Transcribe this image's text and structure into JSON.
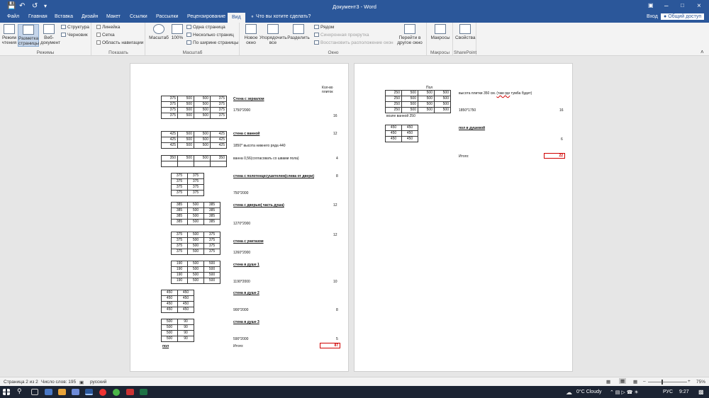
{
  "titlebar": {
    "title": "Документ3 - Word"
  },
  "tabs": [
    "Файл",
    "Главная",
    "Вставка",
    "Дизайн",
    "Макет",
    "Ссылки",
    "Рассылки",
    "Рецензирование",
    "Вид"
  ],
  "tellme": "Что вы хотите сделать?",
  "account": {
    "signin": "Вход",
    "share": "Общий доступ"
  },
  "ribbon": {
    "views": {
      "read": "Режим\nчтения",
      "print": "Разметка\nстраницы",
      "web": "Веб-\nдокумент",
      "outline": "Структура",
      "draft": "Черновик",
      "label": "Режимы"
    },
    "show": {
      "ruler": "Линейка",
      "grid": "Сетка",
      "nav": "Область навигации",
      "label": "Показать"
    },
    "zoom": {
      "zoom": "Масштаб",
      "hundred": "100%",
      "one": "Одна страница",
      "multi": "Несколько страниц",
      "width": "По ширине страницы",
      "label": "Масштаб"
    },
    "window": {
      "new": "Новое\nокно",
      "arrange": "Упорядочить\nвсе",
      "split": "Разделить",
      "side": "Рядом",
      "sync": "Синхронная прокрутка",
      "reset": "Восстановить расположение окон",
      "switch": "Перейти в\nдругое окно",
      "label": "Окно"
    },
    "macros": {
      "macros": "Макросы",
      "label": "Макросы"
    },
    "sp": {
      "props": "Свойства",
      "label": "SharePoint"
    }
  },
  "page1": {
    "header": "Кол-во\nплиток",
    "s1": {
      "rows": [
        [
          "375",
          "500",
          "500",
          "375"
        ],
        [
          "375",
          "500",
          "500",
          "375"
        ],
        [
          "375",
          "500",
          "500",
          "375"
        ],
        [
          "375",
          "500",
          "500",
          "375"
        ]
      ],
      "title": "Стена с зеркалом",
      "dim": "1750*2000",
      "count": "16"
    },
    "s2": {
      "rows": [
        [
          "425",
          "500",
          "500",
          "425"
        ],
        [
          "425",
          "500",
          "500",
          "425"
        ],
        [
          "425",
          "500",
          "500",
          "425"
        ]
      ],
      "title": "стена с ванной",
      "note": "1850* высота нижнего ряда 440",
      "count": "12"
    },
    "s3": {
      "rows": [
        [
          "350",
          "500",
          "500",
          "350"
        ],
        [
          "",
          "",
          "",
          ""
        ]
      ],
      "note": "ванна 0,56(согласовать со швами пола)",
      "count": "4"
    },
    "s4": {
      "rows": [
        [
          "375",
          "375"
        ],
        [
          "375",
          "375"
        ],
        [
          "375",
          "375"
        ],
        [
          "375",
          "375"
        ]
      ],
      "title": "стена с полотенцесушителем(слева от двери)",
      "dim": "750*2000",
      "count": "8"
    },
    "s5": {
      "rows": [
        [
          "385",
          "500",
          "385"
        ],
        [
          "385",
          "500",
          "385"
        ],
        [
          "385",
          "500",
          "385"
        ],
        [
          "385",
          "500",
          "385"
        ]
      ],
      "title": "стена с дверью( часть душа)",
      "dim": "1270*2000",
      "count": "12"
    },
    "s6": {
      "rows": [
        [
          "375",
          "500",
          "375"
        ],
        [
          "375",
          "500",
          "375"
        ],
        [
          "375",
          "500",
          "375"
        ],
        [
          "375",
          "500",
          "375"
        ]
      ],
      "title": "стена с унитазом",
      "dim": "1260*2000",
      "count": "12"
    },
    "s7": {
      "rows": [
        [
          "190",
          "500",
          "500"
        ],
        [
          "190",
          "500",
          "500"
        ],
        [
          "190",
          "500",
          "500"
        ],
        [
          "190",
          "500",
          "500"
        ]
      ],
      "title": "стена в душе 1",
      "dim": "1190*2000",
      "count": "10"
    },
    "s8": {
      "rows": [
        [
          "450",
          "450"
        ],
        [
          "450",
          "450"
        ],
        [
          "450",
          "450"
        ],
        [
          "450",
          "450"
        ]
      ],
      "title": "стена в душе 2",
      "dim": "900*2000",
      "count": "8"
    },
    "s9": {
      "rows": [
        [
          "500",
          "90"
        ],
        [
          "500",
          "90"
        ],
        [
          "500",
          "90"
        ],
        [
          "500",
          "90"
        ]
      ],
      "title": "стена в душе 3",
      "dim": "590*2000",
      "count": "5"
    },
    "floor": "пол",
    "total_label": "Итого:",
    "total": "87"
  },
  "page2": {
    "title": "Пол",
    "t1": {
      "rows": [
        [
          "250",
          "500",
          "500",
          "500"
        ],
        [
          "250",
          "500",
          "500",
          "500"
        ],
        [
          "250",
          "500",
          "500",
          "500"
        ],
        [
          "250",
          "500",
          "500",
          "500"
        ]
      ],
      "note_a": "высота плитки 350 см.",
      "note_b": "(там где",
      "note_c": "тумба будет)",
      "dim": "1850*1750",
      "count": "16",
      "below": "возле ванной 250"
    },
    "t2": {
      "rows": [
        [
          "450",
          "450"
        ],
        [
          "450",
          "450"
        ],
        [
          "450",
          "450"
        ]
      ],
      "title": "пол в душевой",
      "count": "6"
    },
    "total_label": "Итого:",
    "total": "22"
  },
  "status": {
    "page": "Страница 2 из 2",
    "words": "Число слов: 195",
    "lang": "русский",
    "zoom": "75%"
  },
  "taskbar": {
    "weather": "0°C  Cloudy",
    "lang": "РУС",
    "time": "9:27"
  }
}
